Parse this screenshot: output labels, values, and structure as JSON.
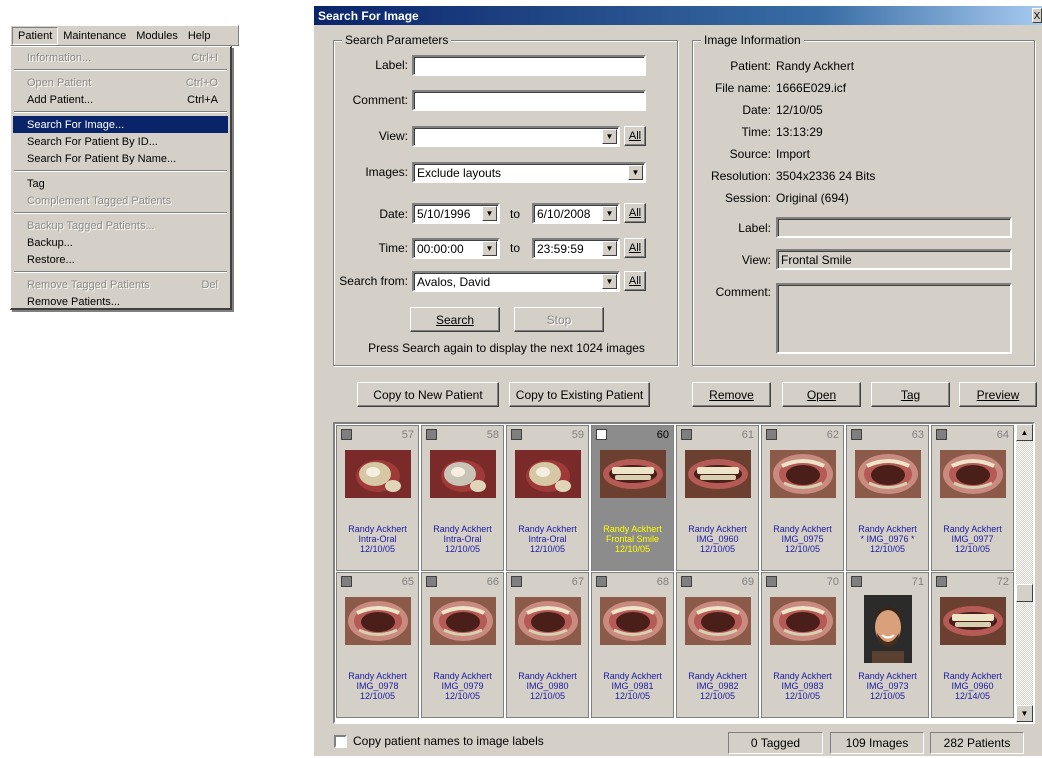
{
  "menubar": {
    "items": [
      "Patient",
      "Maintenance",
      "Modules",
      "Help"
    ]
  },
  "menu": {
    "items": [
      {
        "label": "Information...",
        "shortcut": "Ctrl+I",
        "disabled": true
      },
      {
        "sep": true
      },
      {
        "label": "Open Patient",
        "shortcut": "Ctrl+O",
        "disabled": true
      },
      {
        "label": "Add Patient...",
        "shortcut": "Ctrl+A",
        "disabled": false
      },
      {
        "sep": true
      },
      {
        "label": "Search For Image...",
        "shortcut": "",
        "disabled": false,
        "selected": true
      },
      {
        "label": "Search For Patient By ID...",
        "shortcut": "",
        "disabled": false
      },
      {
        "label": "Search For Patient By Name...",
        "shortcut": "",
        "disabled": false
      },
      {
        "sep": true
      },
      {
        "label": "Tag",
        "shortcut": "",
        "disabled": false
      },
      {
        "label": "Complement Tagged Patients",
        "shortcut": "",
        "disabled": true
      },
      {
        "sep": true
      },
      {
        "label": "Backup Tagged Patients...",
        "shortcut": "",
        "disabled": true
      },
      {
        "label": "Backup...",
        "shortcut": "",
        "disabled": false
      },
      {
        "label": "Restore...",
        "shortcut": "",
        "disabled": false
      },
      {
        "sep": true
      },
      {
        "label": "Remove Tagged Patients",
        "shortcut": "Del",
        "disabled": true
      },
      {
        "label": "Remove Patients...",
        "shortcut": "",
        "disabled": false
      }
    ]
  },
  "dialog": {
    "title": "Search For Image",
    "close": "X"
  },
  "search_params": {
    "title": "Search Parameters",
    "label_label": "Label:",
    "label_value": "",
    "comment_label": "Comment:",
    "comment_value": "",
    "view_label": "View:",
    "view_value": "",
    "images_label": "Images:",
    "images_value": "Exclude layouts",
    "date_label": "Date:",
    "date_from": "5/10/1996",
    "date_to": "6/10/2008",
    "time_label": "Time:",
    "time_from": "00:00:00",
    "time_to": "23:59:59",
    "to_label": "to",
    "search_from_label": "Search from:",
    "search_from_value": "Avalos, David",
    "all_label": "All",
    "search_button": "Search",
    "stop_button": "Stop",
    "hint": "Press Search again to display the next 1024 images"
  },
  "image_info": {
    "title": "Image Information",
    "patient_label": "Patient:",
    "patient": "Randy Ackhert",
    "file_label": "File name:",
    "file": "1666E029.icf",
    "date_label": "Date:",
    "date": "12/10/05",
    "time_label": "Time:",
    "time": "13:13:29",
    "source_label": "Source:",
    "source": "Import",
    "resolution_label": "Resolution:",
    "resolution": "3504x2336 24 Bits",
    "session_label": "Session:",
    "session": "Original (694)",
    "label_label": "Label:",
    "label": "",
    "view_label": "View:",
    "view": "Frontal Smile",
    "comment_label": "Comment:",
    "comment": ""
  },
  "actions": {
    "copy_new": "Copy to New Patient",
    "copy_existing": "Copy to Existing Patient",
    "remove": "Remove",
    "open": "Open",
    "tag": "Tag",
    "preview": "Preview"
  },
  "thumbnails": [
    {
      "num": "57",
      "name": "Randy Ackhert",
      "desc": "Intra-Oral",
      "date": "12/10/05",
      "img": "intraoral-a"
    },
    {
      "num": "58",
      "name": "Randy Ackhert",
      "desc": "Intra-Oral",
      "date": "12/10/05",
      "img": "intraoral-b"
    },
    {
      "num": "59",
      "name": "Randy Ackhert",
      "desc": "Intra-Oral",
      "date": "12/10/05",
      "img": "intraoral-c"
    },
    {
      "num": "60",
      "name": "Randy Ackhert",
      "desc": "Frontal Smile",
      "date": "12/10/05",
      "img": "smile",
      "selected": true
    },
    {
      "num": "61",
      "name": "Randy Ackhert",
      "desc": "IMG_0960",
      "date": "12/10/05",
      "img": "teeth"
    },
    {
      "num": "62",
      "name": "Randy Ackhert",
      "desc": "IMG_0975",
      "date": "12/10/05",
      "img": "retractor"
    },
    {
      "num": "63",
      "name": "Randy Ackhert",
      "desc": "* IMG_0976 *",
      "date": "12/10/05",
      "img": "retractor"
    },
    {
      "num": "64",
      "name": "Randy Ackhert",
      "desc": "IMG_0977",
      "date": "12/10/05",
      "img": "retractor"
    },
    {
      "num": "65",
      "name": "Randy Ackhert",
      "desc": "IMG_0978",
      "date": "12/10/05",
      "img": "retractor"
    },
    {
      "num": "66",
      "name": "Randy Ackhert",
      "desc": "IMG_0979",
      "date": "12/10/05",
      "img": "retractor"
    },
    {
      "num": "67",
      "name": "Randy Ackhert",
      "desc": "IMG_0980",
      "date": "12/10/05",
      "img": "retractor"
    },
    {
      "num": "68",
      "name": "Randy Ackhert",
      "desc": "IMG_0981",
      "date": "12/10/05",
      "img": "retractor"
    },
    {
      "num": "69",
      "name": "Randy Ackhert",
      "desc": "IMG_0982",
      "date": "12/10/05",
      "img": "retractor"
    },
    {
      "num": "70",
      "name": "Randy Ackhert",
      "desc": "IMG_0983",
      "date": "12/10/05",
      "img": "retractor"
    },
    {
      "num": "71",
      "name": "Randy Ackhert",
      "desc": "IMG_0973",
      "date": "12/10/05",
      "img": "portrait"
    },
    {
      "num": "72",
      "name": "Randy Ackhert",
      "desc": "IMG_0960",
      "date": "12/14/05",
      "img": "teeth"
    }
  ],
  "footer": {
    "copy_names_label": "Copy patient names to image labels",
    "tagged": "0 Tagged",
    "images": "109 Images",
    "patients": "282 Patients"
  }
}
